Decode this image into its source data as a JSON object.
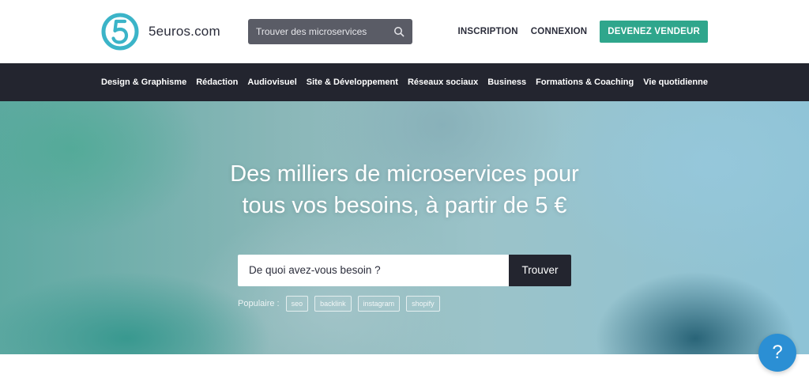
{
  "header": {
    "logo_text": "5euros.com",
    "logo_icon": "five-circle-logo",
    "search_placeholder": "Trouver des microservices",
    "search_icon": "search-icon",
    "links": [
      "INSCRIPTION",
      "CONNEXION"
    ],
    "cta_label": "DEVENEZ VENDEUR",
    "cta_color": "#2fa68c"
  },
  "categories": [
    "Design & Graphisme",
    "Rédaction",
    "Audiovisuel",
    "Site & Développement",
    "Réseaux sociaux",
    "Business",
    "Formations & Coaching",
    "Vie quotidienne"
  ],
  "hero": {
    "title_line1": "Des milliers de microservices pour",
    "title_line2": "tous vos besoins, à partir de 5 €",
    "search_placeholder": "De quoi avez-vous besoin ?",
    "search_button": "Trouver",
    "popular_label": "Populaire :",
    "popular_tags": [
      "seo",
      "backlink",
      "instagram",
      "shopify"
    ]
  },
  "help": {
    "label": "?",
    "color": "#2b8fd4"
  }
}
